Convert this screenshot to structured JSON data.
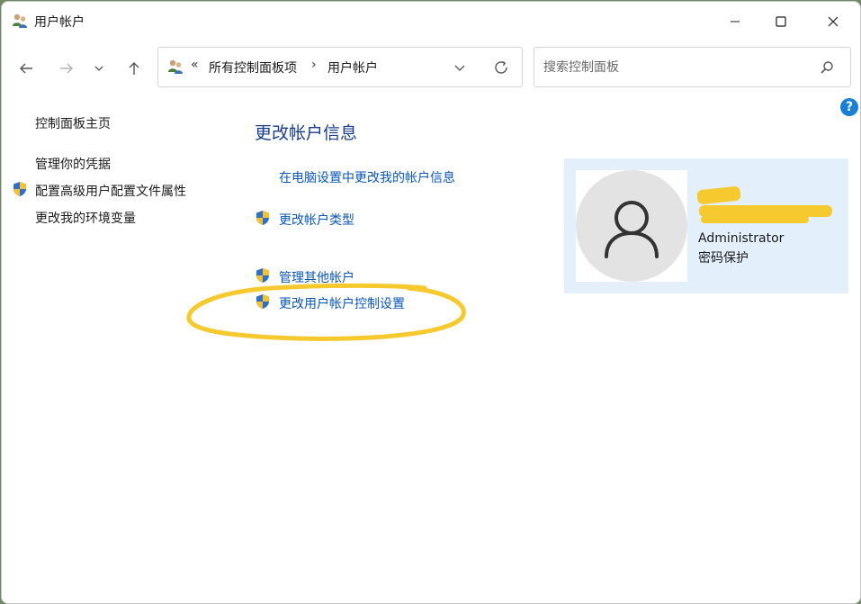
{
  "window": {
    "title": "用户帐户"
  },
  "address": {
    "overflow_glyph": "«",
    "crumbs": [
      "所有控制面板项",
      "用户帐户"
    ],
    "separator": "›"
  },
  "search": {
    "placeholder": "搜索控制面板"
  },
  "help": {
    "label": "?"
  },
  "left_nav": {
    "items": [
      {
        "label": "控制面板主页",
        "shield": false
      },
      {
        "label": "管理你的凭据",
        "shield": false
      },
      {
        "label": "配置高级用户配置文件属性",
        "shield": true
      },
      {
        "label": "更改我的环境变量",
        "shield": false
      }
    ]
  },
  "main": {
    "heading": "更改帐户信息",
    "tasks": [
      {
        "label": "在电脑设置中更改我的帐户信息",
        "shield": false
      },
      {
        "label": "更改帐户类型",
        "shield": true
      },
      {
        "label": "管理其他帐户",
        "shield": true
      },
      {
        "label": "更改用户帐户控制设置",
        "shield": true
      }
    ]
  },
  "account": {
    "type": "Administrator",
    "status": "密码保护"
  },
  "colors": {
    "link": "#0b57b8",
    "heading": "#1a3e8c",
    "card_bg": "#e3f0fc",
    "annotation": "#f6c92e"
  }
}
